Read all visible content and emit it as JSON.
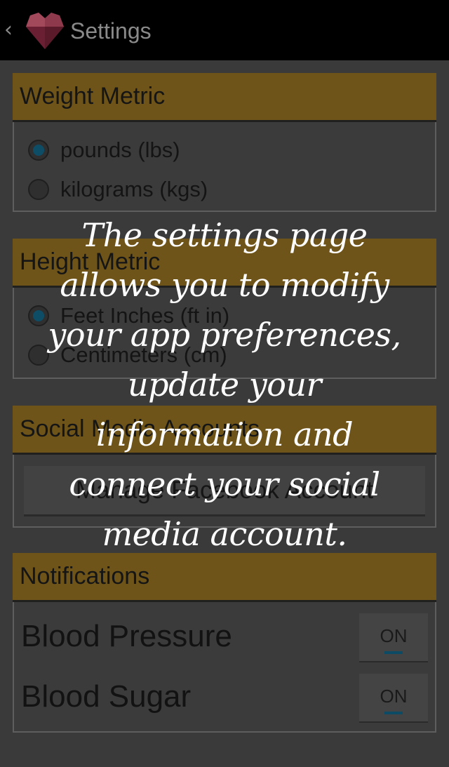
{
  "actionbar": {
    "back_icon": "chevron-left-icon",
    "app_icon": "heart-gem-icon",
    "title": "Settings"
  },
  "colors": {
    "actionbar_bg": "#000000",
    "section_header_bg": "#6e5418",
    "radio_checked": "#0e4d66",
    "overlay_text": "#ffffff"
  },
  "weight_metric": {
    "header": "Weight Metric",
    "options": [
      {
        "label": "pounds (lbs)",
        "checked": true
      },
      {
        "label": "kilograms (kgs)",
        "checked": false
      }
    ]
  },
  "height_metric": {
    "header": "Height Metric",
    "options": [
      {
        "label": "Feet Inches (ft in)",
        "checked": true
      },
      {
        "label": "Centimeters (cm)",
        "checked": false
      }
    ]
  },
  "social": {
    "header": "Social Media Accounts",
    "button_label": "Manage Facebook Account"
  },
  "notifications": {
    "header": "Notifications",
    "items": [
      {
        "label": "Blood Pressure",
        "toggle": "ON"
      },
      {
        "label": "Blood Sugar",
        "toggle": "ON"
      }
    ]
  },
  "overlay": {
    "lines": [
      "The settings page",
      "allows you to modify",
      "your app preferences,",
      "update your",
      "information and",
      "connect your social",
      "media account."
    ]
  }
}
